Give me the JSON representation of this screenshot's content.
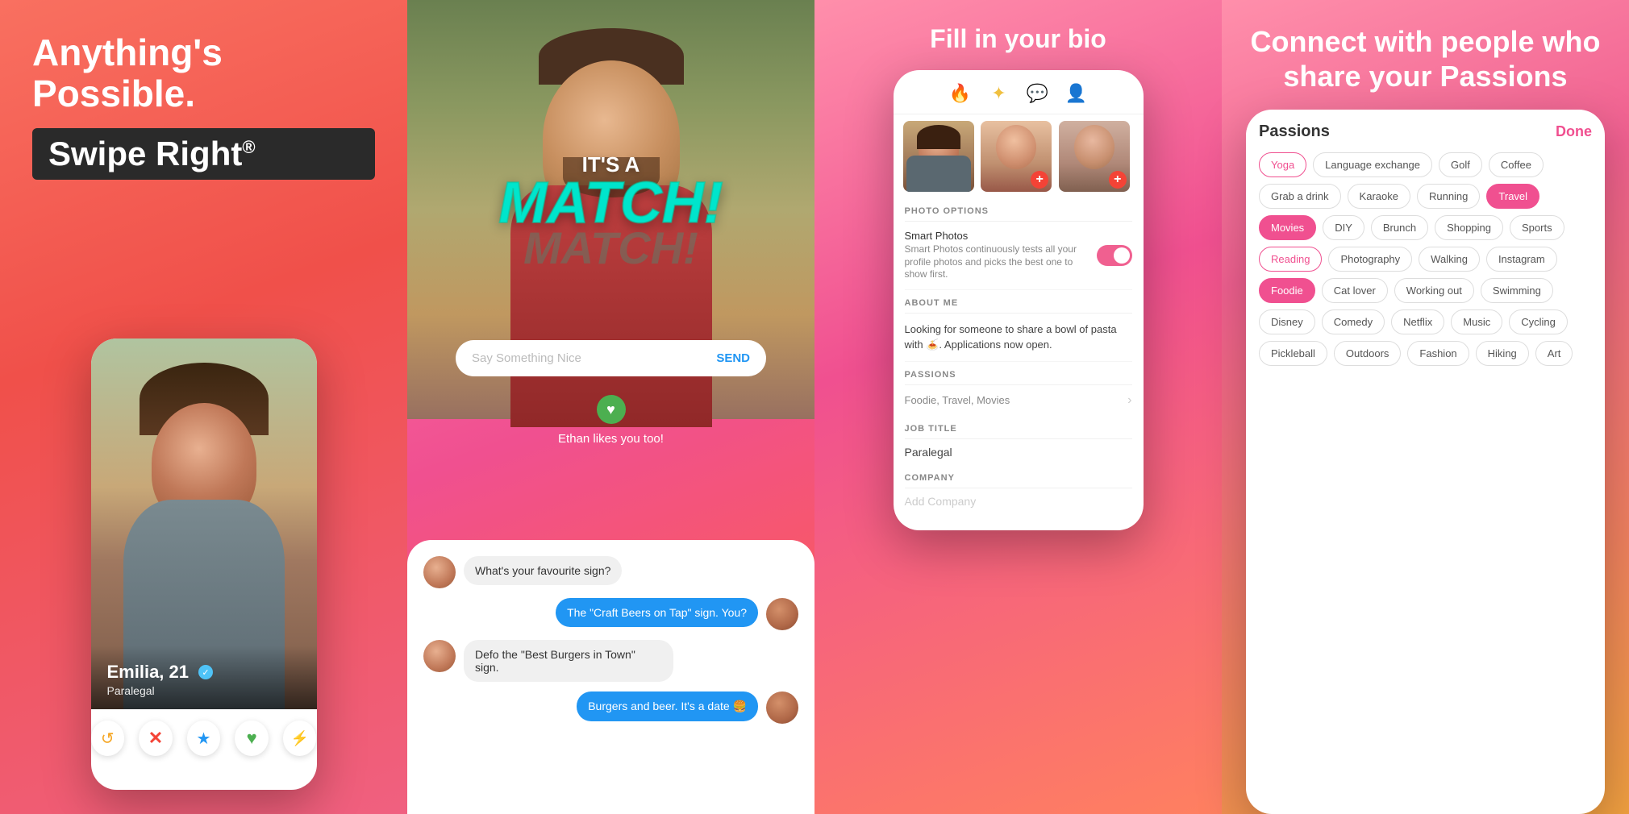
{
  "panel1": {
    "headline_line1": "Anything's",
    "headline_line2": "Possible.",
    "swipe_text": "Swipe Right",
    "swipe_sup": "®",
    "profile_name": "Emilia, 21",
    "profile_job": "Paralegal",
    "btn_undo": "↺",
    "btn_nope": "✕",
    "btn_super": "★",
    "btn_like": "♥",
    "btn_boost": "⚡"
  },
  "panel2": {
    "its_a": "IT'S A",
    "match": "MATCH!",
    "subtitle": "Ethan likes you too!",
    "say_placeholder": "Say Something Nice",
    "send_label": "SEND",
    "chat": [
      {
        "side": "left",
        "text": "What's your favourite sign?",
        "gender": "female"
      },
      {
        "side": "right",
        "text": "The \"Craft Beers on Tap\" sign. You?",
        "gender": "female"
      },
      {
        "side": "left",
        "text": "Defo the \"Best Burgers in Town\" sign.",
        "gender": "female"
      },
      {
        "side": "right",
        "text": "Burgers and beer. It's a date 🍔",
        "gender": "female"
      }
    ]
  },
  "panel3": {
    "headline": "Fill in your bio",
    "photo_options_header": "PHOTO OPTIONS",
    "smart_photos_label": "Smart Photos",
    "smart_photos_desc": "Smart Photos continuously tests all your profile photos and picks the best one to show first.",
    "about_me_header": "ABOUT ME",
    "about_me_text": "Looking for someone to share a bowl of pasta with 🍝. Applications now open.",
    "passions_header": "PASSIONS",
    "passions_value": "Foodie, Travel, Movies",
    "job_title_header": "JOB TITLE",
    "job_title_value": "Paralegal",
    "company_header": "COMPANY",
    "company_placeholder": "Add Company"
  },
  "panel4": {
    "headline": "Connect with people who share your Passions",
    "passions_title": "Passions",
    "done_label": "Done",
    "tags": [
      {
        "label": "Yoga",
        "state": "selected"
      },
      {
        "label": "Language exchange",
        "state": "normal"
      },
      {
        "label": "Golf",
        "state": "normal"
      },
      {
        "label": "Coffee",
        "state": "normal"
      },
      {
        "label": "Grab a drink",
        "state": "normal"
      },
      {
        "label": "Karaoke",
        "state": "normal"
      },
      {
        "label": "Running",
        "state": "normal"
      },
      {
        "label": "Travel",
        "state": "selected-fill"
      },
      {
        "label": "Movies",
        "state": "selected-fill"
      },
      {
        "label": "DIY",
        "state": "normal"
      },
      {
        "label": "Brunch",
        "state": "normal"
      },
      {
        "label": "Shopping",
        "state": "normal"
      },
      {
        "label": "Sports",
        "state": "normal"
      },
      {
        "label": "Reading",
        "state": "selected"
      },
      {
        "label": "Photography",
        "state": "normal"
      },
      {
        "label": "Walking",
        "state": "normal"
      },
      {
        "label": "Instagram",
        "state": "normal"
      },
      {
        "label": "Foodie",
        "state": "selected-fill"
      },
      {
        "label": "Cat lover",
        "state": "normal"
      },
      {
        "label": "Working out",
        "state": "normal"
      },
      {
        "label": "Swimming",
        "state": "normal"
      },
      {
        "label": "Disney",
        "state": "normal"
      },
      {
        "label": "Comedy",
        "state": "normal"
      },
      {
        "label": "Netflix",
        "state": "normal"
      },
      {
        "label": "Music",
        "state": "normal"
      },
      {
        "label": "Cycling",
        "state": "normal"
      },
      {
        "label": "Pickleball",
        "state": "normal"
      },
      {
        "label": "Outdoors",
        "state": "normal"
      },
      {
        "label": "Fashion",
        "state": "normal"
      },
      {
        "label": "Hiking",
        "state": "normal"
      },
      {
        "label": "Art",
        "state": "normal"
      }
    ]
  }
}
